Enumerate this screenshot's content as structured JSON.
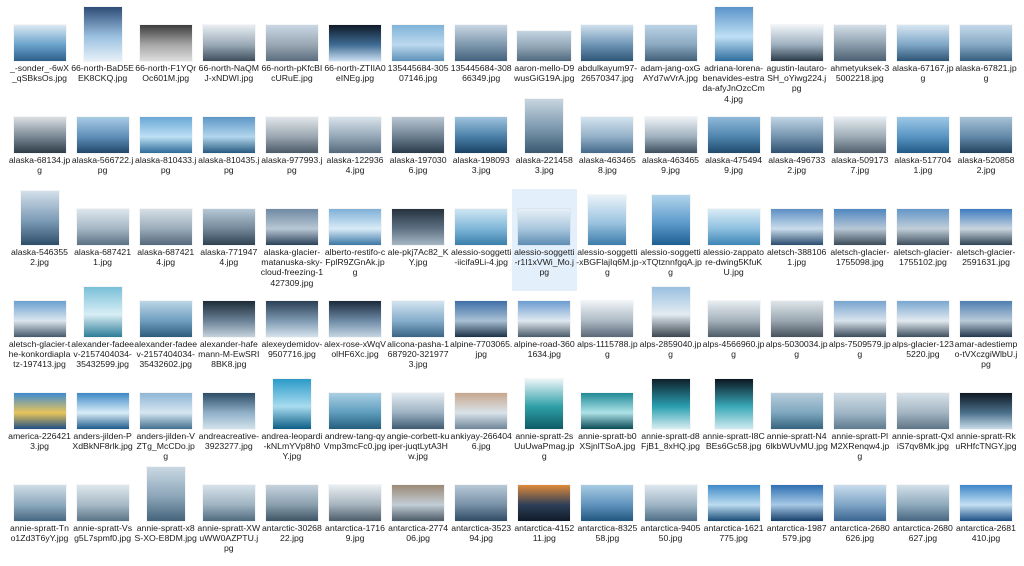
{
  "window": {
    "title": ""
  },
  "files": [
    {
      "name": "_-sonder_-6wX_qSBksOs.jpg",
      "shape": "land",
      "colors": [
        "#dce9f3",
        "#6aa2cc",
        "#2d5f8a"
      ]
    },
    {
      "name": "66-north-BaD5EEK8CKQ.jpg",
      "shape": "tall",
      "colors": [
        "#2e4d78",
        "#9cc1e0",
        "#e6f0f8"
      ]
    },
    {
      "name": "66-north-F1YQrOc601M.jpg",
      "shape": "land",
      "colors": [
        "#3d3d3d",
        "#a7a7a7",
        "#dedede"
      ]
    },
    {
      "name": "66-north-NaQMJ-xNDWI.jpg",
      "shape": "land",
      "colors": [
        "#e8eef3",
        "#9aa9b6",
        "#3e4e5c"
      ]
    },
    {
      "name": "66-north-pKfcBIcURuE.jpg",
      "shape": "land",
      "colors": [
        "#c9d7e4",
        "#9aa7b3",
        "#5a6d7f"
      ]
    },
    {
      "name": "66-north-ZTIIA0eINEg.jpg",
      "shape": "land",
      "colors": [
        "#0f1a28",
        "#3f6b93",
        "#c9dff0"
      ]
    },
    {
      "name": "135445684-30507146.jpg",
      "shape": "land",
      "colors": [
        "#7fb3d8",
        "#bcd9ee",
        "#5d91b8"
      ]
    },
    {
      "name": "135445684-30866349.jpg",
      "shape": "land",
      "colors": [
        "#c8d6e2",
        "#7e98ad",
        "#44627c"
      ]
    },
    {
      "name": "aaron-mello-D9wusGiG19A.jpg",
      "shape": "wide",
      "colors": [
        "#c3d4e2",
        "#8fa3b3",
        "#50697e"
      ]
    },
    {
      "name": "abdulkayum97-26570347.jpg",
      "shape": "land",
      "colors": [
        "#cfe0ee",
        "#6e94b5",
        "#2f5677"
      ]
    },
    {
      "name": "adam-jang-oxGAYd7wVrA.jpg",
      "shape": "land",
      "colors": [
        "#bcd3e6",
        "#8aa8c0",
        "#425f78"
      ]
    },
    {
      "name": "adriana-lorena-benavides-estrada-afyJnOzcCm4.jpg",
      "shape": "tall",
      "colors": [
        "#5a94c9",
        "#bfe0f5",
        "#2f6e9e"
      ]
    },
    {
      "name": "agustin-lautaro-SH_oYiwg224.jpg",
      "shape": "land",
      "colors": [
        "#f0f4f7",
        "#9eb0bf",
        "#2a3a48"
      ]
    },
    {
      "name": "ahmetyuksek-35002218.jpg",
      "shape": "land",
      "colors": [
        "#d4dfe8",
        "#8b9dac",
        "#4b6072"
      ]
    },
    {
      "name": "alaska-67167.jpg",
      "shape": "land",
      "colors": [
        "#d7e6f2",
        "#7ea6c6",
        "#2f5474"
      ]
    },
    {
      "name": "alaska-67821.jpg",
      "shape": "land",
      "colors": [
        "#c5d9ea",
        "#86a9c4",
        "#365d7c"
      ]
    },
    {
      "name": "alaska-68134.jpg",
      "shape": "land",
      "colors": [
        "#dcdfe3",
        "#798894",
        "#2e3c48"
      ]
    },
    {
      "name": "alaska-566722.jpg",
      "shape": "land",
      "colors": [
        "#a9cbe5",
        "#5e8fb8",
        "#21476a"
      ]
    },
    {
      "name": "alaska-810433.jpg",
      "shape": "land",
      "colors": [
        "#6aa8d6",
        "#bde0f5",
        "#2e6c99"
      ]
    },
    {
      "name": "alaska-810435.jpg",
      "shape": "land",
      "colors": [
        "#5d97c6",
        "#b2d6ee",
        "#27597f"
      ]
    },
    {
      "name": "alaska-977993.jpg",
      "shape": "land",
      "colors": [
        "#e1e6ea",
        "#9aa6b0",
        "#4b5a67"
      ]
    },
    {
      "name": "alaska-1229364.jpg",
      "shape": "land",
      "colors": [
        "#d9e3eb",
        "#94a7b7",
        "#546a7c"
      ]
    },
    {
      "name": "alaska-1970306.jpg",
      "shape": "land",
      "colors": [
        "#b9c6d1",
        "#6b7f90",
        "#2a3b4a"
      ]
    },
    {
      "name": "alaska-1980933.jpg",
      "shape": "land",
      "colors": [
        "#9fc3dd",
        "#4a7fa8",
        "#1a4263"
      ]
    },
    {
      "name": "alaska-2214583.jpg",
      "shape": "tall",
      "colors": [
        "#c7d5df",
        "#7b98ae",
        "#3a586f"
      ]
    },
    {
      "name": "alaska-4634658.jpg",
      "shape": "land",
      "colors": [
        "#d4e3ef",
        "#93b0c8",
        "#44698a"
      ]
    },
    {
      "name": "alaska-4634659.jpg",
      "shape": "land",
      "colors": [
        "#eef2f5",
        "#9fb0be",
        "#3d4f5e"
      ]
    },
    {
      "name": "alaska-4754949.jpg",
      "shape": "land",
      "colors": [
        "#8fb9d9",
        "#4f84ad",
        "#1f4a6c"
      ]
    },
    {
      "name": "alaska-4967332.jpg",
      "shape": "land",
      "colors": [
        "#c0d4e4",
        "#7393ad",
        "#2f5070"
      ]
    },
    {
      "name": "alaska-5091737.jpg",
      "shape": "land",
      "colors": [
        "#e6ecf0",
        "#9dabb6",
        "#505f6b"
      ]
    },
    {
      "name": "alaska-5177041.jpg",
      "shape": "land",
      "colors": [
        "#9cc8e6",
        "#5894c2",
        "#225a85"
      ]
    },
    {
      "name": "alaska-5208582.jpg",
      "shape": "land",
      "colors": [
        "#a8c2d6",
        "#6289a8",
        "#22435e"
      ]
    },
    {
      "name": "alaska-5463552.jpg",
      "shape": "tall",
      "colors": [
        "#d3dfea",
        "#7c9bb6",
        "#2d4d69"
      ]
    },
    {
      "name": "alaska-6874211.jpg",
      "shape": "land",
      "colors": [
        "#dde6ed",
        "#a4b6c4",
        "#5a7184"
      ]
    },
    {
      "name": "alaska-6874214.jpg",
      "shape": "land",
      "colors": [
        "#d6dfe6",
        "#9aabb9",
        "#56697a"
      ]
    },
    {
      "name": "alaska-7719474.jpg",
      "shape": "land",
      "colors": [
        "#b6c8d6",
        "#74889a",
        "#2f4252"
      ]
    },
    {
      "name": "alaska-glacier-matanuska-sky-cloud-freezing-1427309.jpg",
      "shape": "land",
      "colors": [
        "#6f8aa3",
        "#b8c7d4",
        "#2b4158"
      ]
    },
    {
      "name": "alberto-restifo-cFplR9ZGnAk.jpg",
      "shape": "land",
      "colors": [
        "#7fb0d6",
        "#d8ebf7",
        "#3b76a5"
      ]
    },
    {
      "name": "ale-pkj7Ac82_KY.jpg",
      "shape": "land",
      "colors": [
        "#26323d",
        "#5e7284",
        "#a6b6c3"
      ]
    },
    {
      "name": "alessio-soggetti-iicifa9Li-4.jpg",
      "shape": "land",
      "colors": [
        "#cfe6f3",
        "#7fb6d8",
        "#3a7eaa"
      ]
    },
    {
      "name": "alessio-soggetti-r1I1xVWi_Mo.jpg",
      "shape": "land",
      "colors": [
        "#e6f0f7",
        "#a9c6dd",
        "#5d8db3"
      ]
    },
    {
      "name": "alessio-soggetti-xBGFlajIq6M.jpg",
      "shape": "portrait",
      "colors": [
        "#eaf3f9",
        "#9cc4e0",
        "#3d7cab"
      ]
    },
    {
      "name": "alessio-soggetti-xTQtznnfgqA.jpg",
      "shape": "portrait",
      "colors": [
        "#b2d4ec",
        "#5e9ccc",
        "#1e5f92"
      ]
    },
    {
      "name": "alessio-zappatore-dwing5KfuKU.jpg",
      "shape": "land",
      "colors": [
        "#d9ecf6",
        "#8dbfdf",
        "#3e86b6"
      ]
    },
    {
      "name": "aletsch-3881061.jpg",
      "shape": "land",
      "colors": [
        "#5d8fc4",
        "#c9dcea",
        "#2b4c6f"
      ]
    },
    {
      "name": "aletsch-glacier-1755098.jpg",
      "shape": "land",
      "colors": [
        "#4f86c0",
        "#b8c8d6",
        "#3a4a56"
      ]
    },
    {
      "name": "aletsch-glacier-1755102.jpg",
      "shape": "land",
      "colors": [
        "#6396c8",
        "#c1ced8",
        "#3d4f5e"
      ]
    },
    {
      "name": "aletsch-glacier-2591631.jpg",
      "shape": "land",
      "colors": [
        "#3f7bbf",
        "#c9d5df",
        "#2f4454"
      ]
    },
    {
      "name": "aletsch-glacier-the-konkordiaplatz-197413.jpg",
      "shape": "land",
      "colors": [
        "#6aa0d0",
        "#dbe6ee",
        "#45596a"
      ]
    },
    {
      "name": "alexander-fadeev-2157404034-35432599.jpg",
      "shape": "portrait",
      "colors": [
        "#7ac0d8",
        "#d8eef5",
        "#2e7c97"
      ]
    },
    {
      "name": "alexander-fadeev-2157404034-35432602.jpg",
      "shape": "land",
      "colors": [
        "#bcd6e6",
        "#6f9ebf",
        "#2d5b7b"
      ]
    },
    {
      "name": "alexander-hafemann-M-EwSRI8BK8.jpg",
      "shape": "land",
      "colors": [
        "#1d2b37",
        "#6a8196",
        "#c5d2dc"
      ]
    },
    {
      "name": "alexeydemidov-9507716.jpg",
      "shape": "land",
      "colors": [
        "#2a3f54",
        "#7e9ab2",
        "#d5e2ec"
      ]
    },
    {
      "name": "alex-rose-xWqVolHF6Xc.jpg",
      "shape": "land",
      "colors": [
        "#1b2a3b",
        "#6d8aa6",
        "#c6d6e3"
      ]
    },
    {
      "name": "alicona-pasha-1687920-3219773.jpg",
      "shape": "land",
      "colors": [
        "#d3e4f0",
        "#86adcb",
        "#3a6485"
      ]
    },
    {
      "name": "alpine-7703065.jpg",
      "shape": "land",
      "colors": [
        "#3f6fa8",
        "#a8c0d4",
        "#1e3246"
      ]
    },
    {
      "name": "alpine-road-3601634.jpg",
      "shape": "land",
      "colors": [
        "#6b9cd0",
        "#dfe8ef",
        "#4a5b69"
      ]
    },
    {
      "name": "alps-1115788.jpg",
      "shape": "land",
      "colors": [
        "#eff3f6",
        "#adbac5",
        "#5a6877"
      ]
    },
    {
      "name": "alps-2859040.jpg",
      "shape": "portrait",
      "colors": [
        "#9ac0e0",
        "#e4ecf2",
        "#3a4650"
      ]
    },
    {
      "name": "alps-4566960.jpg",
      "shape": "land",
      "colors": [
        "#e7edf1",
        "#a4b1bb",
        "#4e5c68"
      ]
    },
    {
      "name": "alps-5030034.jpg",
      "shape": "land",
      "colors": [
        "#dfe6ea",
        "#9aa7b1",
        "#46525c"
      ]
    },
    {
      "name": "alps-7509579.jpg",
      "shape": "land",
      "colors": [
        "#78a5cf",
        "#d8e3ec",
        "#3c4c5a"
      ]
    },
    {
      "name": "alps-glacier-1235220.jpg",
      "shape": "land",
      "colors": [
        "#7aa7d0",
        "#e2eaf0",
        "#3d4e5d"
      ]
    },
    {
      "name": "amar-adestiempo-tVXczgiWlbU.jpg",
      "shape": "land",
      "colors": [
        "#4f7fb1",
        "#b9cad8",
        "#24394e"
      ]
    },
    {
      "name": "america-2264213.jpg",
      "shape": "land",
      "colors": [
        "#3d8bd0",
        "#e8c45a",
        "#1f4f86"
      ]
    },
    {
      "name": "anders-jilden-PXdBkNF8rlk.jpg",
      "shape": "land",
      "colors": [
        "#3d88c6",
        "#d9edf8",
        "#1f5b8b"
      ]
    },
    {
      "name": "anders-jilden-VZTg_McCDo.jpg",
      "shape": "land",
      "colors": [
        "#8fb6d5",
        "#d6e6f1",
        "#43708f"
      ]
    },
    {
      "name": "andreacreative-3923277.jpg",
      "shape": "land",
      "colors": [
        "#2d4c66",
        "#8fb0c7",
        "#d2e2ec"
      ]
    },
    {
      "name": "andrea-leopardi-kNLmYVp8h0Y.jpg",
      "shape": "portrait",
      "colors": [
        "#2b9ac8",
        "#a8dcf0",
        "#0d5f86"
      ]
    },
    {
      "name": "andrew-tang-qyVmp3mcFc0.jpg",
      "shape": "land",
      "colors": [
        "#a9d0e4",
        "#5e9cbd",
        "#245e7c"
      ]
    },
    {
      "name": "angie-corbett-kuiper-juqtLytA3Hw.jpg",
      "shape": "land",
      "colors": [
        "#e3ebf1",
        "#9cb1c2",
        "#3f5b72"
      ]
    },
    {
      "name": "ankiyay-2664046.jpg",
      "shape": "land",
      "colors": [
        "#c8a78d",
        "#d9e3ea",
        "#6f8699"
      ]
    },
    {
      "name": "annie-spratt-2sUuUwaPmag.jpg",
      "shape": "portrait",
      "colors": [
        "#ecf5f7",
        "#2fa0a8",
        "#0e5b66"
      ]
    },
    {
      "name": "annie-spratt-b0XSjnlTSoA.jpg",
      "shape": "land",
      "colors": [
        "#1f8a96",
        "#aee2e8",
        "#0a4b55"
      ]
    },
    {
      "name": "annie-spratt-d8FjB1_8xHQ.jpg",
      "shape": "portrait",
      "colors": [
        "#0e1f2a",
        "#2a9fb0",
        "#d8eef2"
      ]
    },
    {
      "name": "annie-spratt-I8CBEs6Gc58.jpg",
      "shape": "portrait",
      "colors": [
        "#0b1620",
        "#3aa8b8",
        "#cfeaf0"
      ]
    },
    {
      "name": "annie-spratt-N46lkbWUvMU.jpg",
      "shape": "land",
      "colors": [
        "#b8ccdb",
        "#7ea7bf",
        "#36647e"
      ]
    },
    {
      "name": "annie-spratt-PlM2XRenqw4.jpg",
      "shape": "land",
      "colors": [
        "#cfdbe4",
        "#9fb6c6",
        "#5f7b8f"
      ]
    },
    {
      "name": "annie-spratt-QxliS7qv8Mk.jpg",
      "shape": "land",
      "colors": [
        "#d7e1e8",
        "#a3b5c2",
        "#5e7587"
      ]
    },
    {
      "name": "annie-spratt-RkuRHfcTNGY.jpg",
      "shape": "land",
      "colors": [
        "#0f1822",
        "#4b6f8a",
        "#c8dce9"
      ]
    },
    {
      "name": "annie-spratt-Tno1Zd3T6yY.jpg",
      "shape": "land",
      "colors": [
        "#cfdde7",
        "#8da9bd",
        "#476781"
      ]
    },
    {
      "name": "annie-spratt-Vsg5L7spmf0.jpg",
      "shape": "land",
      "colors": [
        "#dee7ed",
        "#a6b9c6",
        "#5a7386"
      ]
    },
    {
      "name": "annie-spratt-x8S-XO-E8DM.jpg",
      "shape": "tall",
      "colors": [
        "#cad9e3",
        "#8ba5b8",
        "#44637a"
      ]
    },
    {
      "name": "annie-spratt-XWuWW0AZPTU.jpg",
      "shape": "land",
      "colors": [
        "#d6e2ea",
        "#9fb3c1",
        "#506b7e"
      ]
    },
    {
      "name": "antarctic-3026822.jpg",
      "shape": "land",
      "colors": [
        "#c6d3dd",
        "#8a9fae",
        "#3f5464"
      ]
    },
    {
      "name": "antarctica-17169.jpg",
      "shape": "land",
      "colors": [
        "#e9eef1",
        "#a6b4be",
        "#4d5d69"
      ]
    },
    {
      "name": "antarctica-277406.jpg",
      "shape": "land",
      "colors": [
        "#9c8a76",
        "#c2cdd5",
        "#4b5a66"
      ]
    },
    {
      "name": "antarctica-352394.jpg",
      "shape": "land",
      "colors": [
        "#b8c8d6",
        "#7891a7",
        "#2f4b63"
      ]
    },
    {
      "name": "antarctica-415211.jpg",
      "shape": "land",
      "colors": [
        "#e08a3a",
        "#2e3f58",
        "#0f1a28"
      ]
    },
    {
      "name": "antarctica-832558.jpg",
      "shape": "land",
      "colors": [
        "#a9cbe4",
        "#5f93bd",
        "#22577f"
      ]
    },
    {
      "name": "antarctica-940550.jpg",
      "shape": "land",
      "colors": [
        "#dde7ee",
        "#9fb5c5",
        "#4f6e86"
      ]
    },
    {
      "name": "antarctica-1621775.jpg",
      "shape": "land",
      "colors": [
        "#3f8ac8",
        "#bcdcf0",
        "#1a4c78"
      ]
    },
    {
      "name": "antarctica-1987579.jpg",
      "shape": "land",
      "colors": [
        "#2f6fb3",
        "#a7c9e6",
        "#163f6b"
      ]
    },
    {
      "name": "antarctica-2680626.jpg",
      "shape": "land",
      "colors": [
        "#c9dcec",
        "#7fa5c6",
        "#3a6590"
      ]
    },
    {
      "name": "antarctica-2680627.jpg",
      "shape": "land",
      "colors": [
        "#d3e0ea",
        "#8fa9bd",
        "#476680"
      ]
    },
    {
      "name": "antarctica-2681410.jpg",
      "shape": "land",
      "colors": [
        "#3d85c8",
        "#c4e0f3",
        "#1d5085"
      ]
    }
  ],
  "selected_file": "alessio-soggetti-r1I1xVWi_Mo.jpg",
  "colors": {
    "selection": "#e3effa",
    "text": "#1a1a1a",
    "background": "#ffffff"
  }
}
